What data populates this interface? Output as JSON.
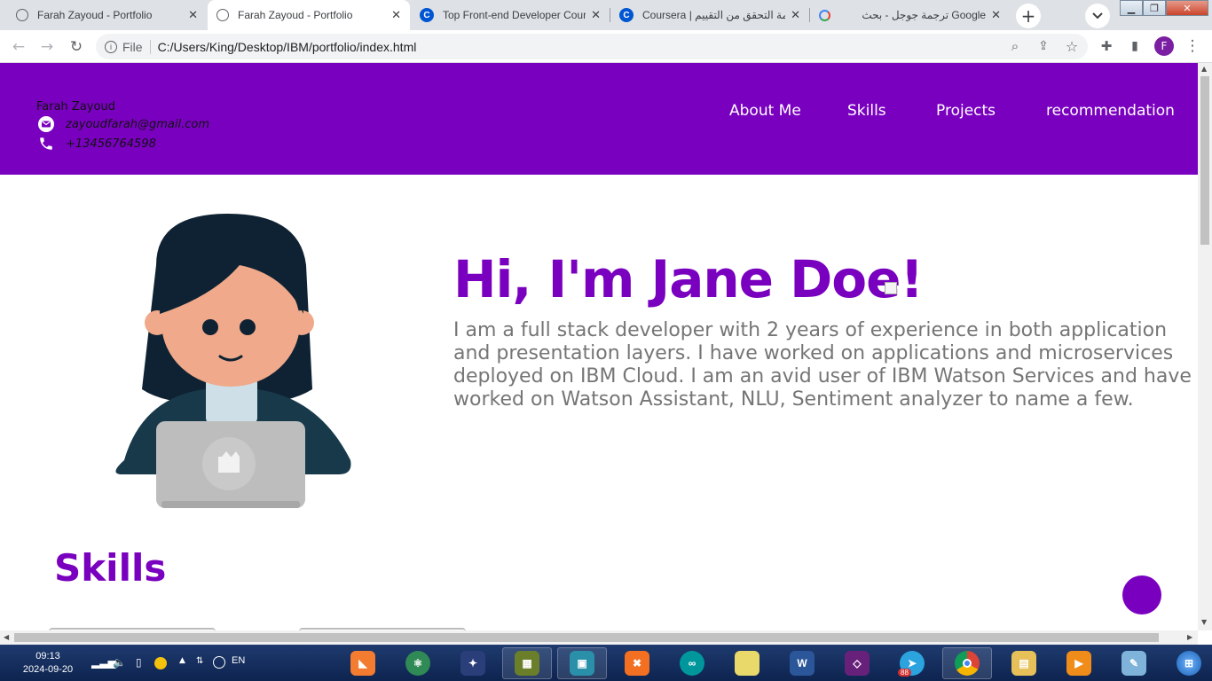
{
  "browser": {
    "tabs": [
      {
        "title": "Farah Zayoud - Portfolio",
        "active": false,
        "favicon": "globe-icon"
      },
      {
        "title": "Farah Zayoud - Portfolio",
        "active": true,
        "favicon": "globe-icon"
      },
      {
        "title": "Top Front-end Developer Cour",
        "active": false,
        "favicon": "coursera-icon"
      },
      {
        "title": "Coursera | قائمة التحقق من التقييم",
        "active": false,
        "favicon": "coursera-icon"
      },
      {
        "title": "ترجمة جوجل - بحث Google",
        "active": false,
        "favicon": "google-icon"
      }
    ],
    "address": {
      "scheme_label": "File",
      "url": "C:/Users/King/Desktop/IBM/portfolio/index.html"
    },
    "profile_initial": "F"
  },
  "site": {
    "header": {
      "name": "Farah Zayoud",
      "email": "zayoudfarah@gmail.com",
      "phone": "+13456764598",
      "nav": [
        "About Me",
        "Skills",
        "Projects",
        "recommendation"
      ]
    },
    "hero": {
      "title": "Hi, I'm Jane Doe!",
      "description": "I am a full stack developer with 2 years of experience in both application and presentation layers. I have worked on applications and microservices deployed on IBM Cloud. I am an avid user of IBM Watson Services and have worked on Watson Assistant, NLU, Sentiment analyzer to name a few."
    },
    "skills": {
      "title": "Skills"
    },
    "colors": {
      "brand": "#7a00c0",
      "text_gray": "#757575"
    }
  },
  "taskbar": {
    "time": "09:13",
    "date": "2024-09-20",
    "language": "EN",
    "apps": [
      "blender-icon",
      "atom-icon",
      "vs-icon",
      "terminal-icon",
      "vm-icon",
      "xampp-icon",
      "arduino-icon",
      "sticky-notes-icon",
      "word-icon",
      "visual-studio-icon",
      "telegram-icon",
      "chrome-icon",
      "explorer-icon",
      "media-icon",
      "paint-icon"
    ],
    "telegram_badge": "88"
  }
}
